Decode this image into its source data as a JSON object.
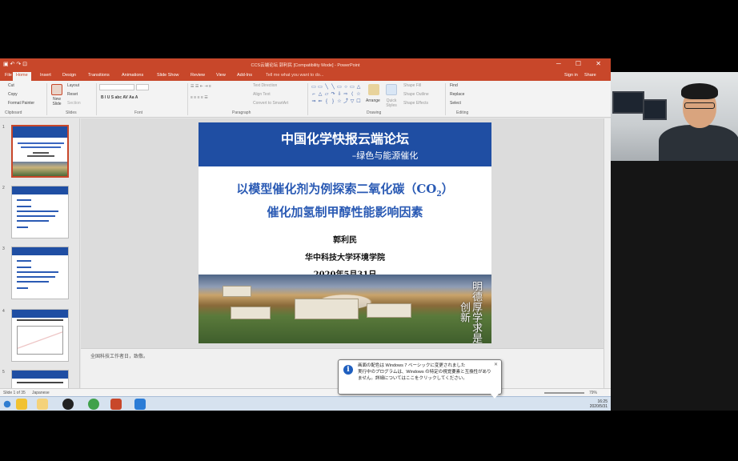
{
  "window": {
    "title": "CCS云端论坛 郭利民 [Compatibility Mode] - PowerPoint",
    "signin": "Sign in",
    "share": "Share",
    "tell_me": "Tell me what you want to do..."
  },
  "ribbon": {
    "tabs": [
      "File",
      "Home",
      "Insert",
      "Design",
      "Transitions",
      "Animations",
      "Slide Show",
      "Review",
      "View",
      "Add-Ins"
    ],
    "active_tab": "Home",
    "clipboard": {
      "cut": "Cut",
      "copy": "Copy",
      "format_painter": "Format Painter",
      "group": "Clipboard"
    },
    "slides": {
      "new_slide": "New Slide",
      "layout": "Layout",
      "reset": "Reset",
      "section": "Section",
      "group": "Slides"
    },
    "font": {
      "group": "Font"
    },
    "paragraph": {
      "text_direction": "Text Direction",
      "align_text": "Align Text",
      "convert_smartart": "Convert to SmartArt",
      "group": "Paragraph"
    },
    "drawing": {
      "arrange": "Arrange",
      "quick_styles": "Quick Styles",
      "shape_fill": "Shape Fill",
      "shape_outline": "Shape Outline",
      "shape_effects": "Shape Effects",
      "group": "Drawing"
    },
    "editing": {
      "find": "Find",
      "replace": "Replace",
      "select": "Select",
      "group": "Editing"
    }
  },
  "slide": {
    "banner_title": "中国化学快报云端论坛",
    "banner_subtitle": "–绿色与能源催化",
    "topic_line1": "以模型催化剂为例探索二氧化碳（CO",
    "topic_sub": "2",
    "topic_line1_end": "）",
    "topic_line2": "催化加氢制甲醇性能影响因素",
    "author": "郭利民",
    "affiliation": "华中科技大学环境学院",
    "date": "2020年5月31日",
    "calligraphy": "明德厚学求是创新"
  },
  "thumbnails": [
    {
      "num": "1"
    },
    {
      "num": "2"
    },
    {
      "num": "3"
    },
    {
      "num": "4"
    },
    {
      "num": "5"
    }
  ],
  "notes": "全国科技工作者日，致敬。",
  "statusbar": {
    "slide": "Slide 1 of 35",
    "lang": "Japanese",
    "zoom": "79%"
  },
  "balloon": {
    "title": "画面の配色は Windows 7 ベーシックに変更されました",
    "body": "実行中のプログラムは、Windows の特定の視覚要素と互換性がありません。詳細についてはここをクリックしてください。"
  },
  "tray": {
    "time": "16:25",
    "date": "2020/5/31"
  },
  "colors": {
    "ppt_accent": "#c8472a",
    "slide_blue": "#1f4ea3",
    "topic_blue": "#2a5ab4"
  }
}
